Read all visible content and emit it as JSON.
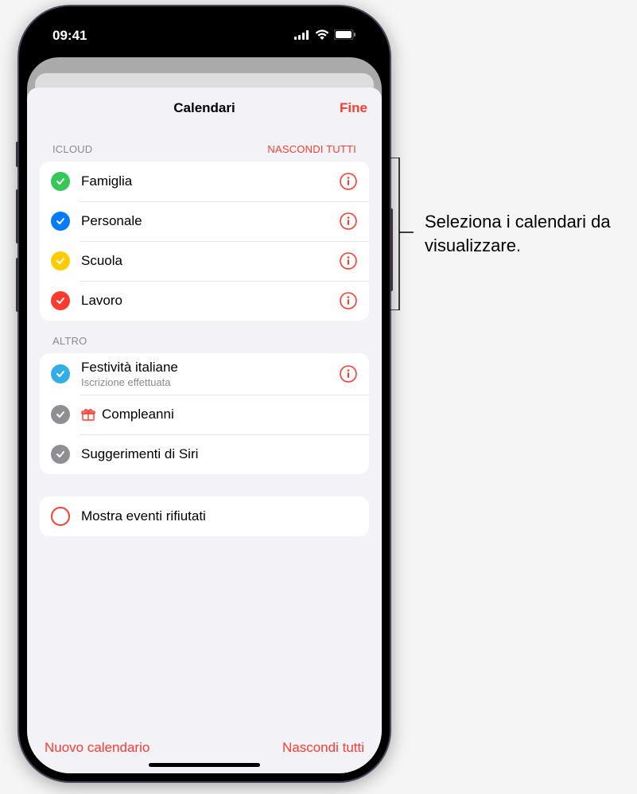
{
  "status": {
    "time": "09:41"
  },
  "sheet": {
    "title": "Calendari",
    "done": "Fine"
  },
  "sections": {
    "icloud": {
      "label": "ICLOUD",
      "action": "NASCONDI TUTTI",
      "items": [
        {
          "label": "Famiglia",
          "color": "#34c759"
        },
        {
          "label": "Personale",
          "color": "#007aff"
        },
        {
          "label": "Scuola",
          "color": "#ffcc00"
        },
        {
          "label": "Lavoro",
          "color": "#ff3b30"
        }
      ]
    },
    "other": {
      "label": "ALTRO",
      "items": [
        {
          "label": "Festività italiane",
          "sublabel": "Iscrizione effettuata",
          "color": "#32ade6",
          "info": true
        },
        {
          "label": "Compleanni",
          "color": "#8e8e93",
          "gift": true
        },
        {
          "label": "Suggerimenti di Siri",
          "color": "#8e8e93"
        }
      ]
    },
    "declined": {
      "label": "Mostra eventi rifiutati"
    }
  },
  "footer": {
    "new": "Nuovo calendario",
    "hide_all": "Nascondi tutti"
  },
  "callout": "Seleziona i calendari da visualizzare."
}
